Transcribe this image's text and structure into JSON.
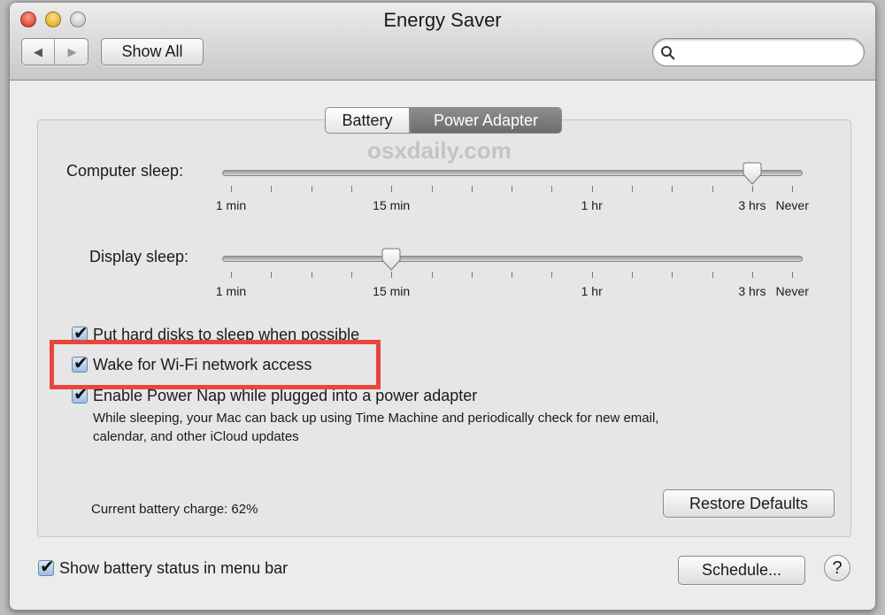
{
  "window": {
    "title": "Energy Saver",
    "show_all": "Show All",
    "search_placeholder": "",
    "back_icon": "back-arrow-icon",
    "forward_icon": "forward-arrow-icon"
  },
  "tabs": [
    {
      "label": "Battery",
      "selected": false
    },
    {
      "label": "Power Adapter",
      "selected": true
    }
  ],
  "watermark": "osxdaily.com",
  "sliders": [
    {
      "label": "Computer sleep:",
      "value": "3 hrs",
      "ticks": 15,
      "value_tick": 13
    },
    {
      "label": "Display sleep:",
      "value": "15 min",
      "ticks": 15,
      "value_tick": 4
    }
  ],
  "tick_labels": [
    {
      "text": "1 min",
      "tick": 0
    },
    {
      "text": "15 min",
      "tick": 4
    },
    {
      "text": "1 hr",
      "tick": 9
    },
    {
      "text": "3 hrs",
      "tick": 13
    },
    {
      "text": "Never",
      "tick": 14
    }
  ],
  "options": [
    {
      "label": "Put hard disks to sleep when possible",
      "checked": true
    },
    {
      "label": "Wake for Wi-Fi network access",
      "checked": true,
      "highlighted": true
    },
    {
      "label": "Enable Power Nap while plugged into a power adapter",
      "checked": true,
      "description_line1": "While sleeping, your Mac can back up using Time Machine and periodically check for new email,",
      "description_line2": "calendar, and other iCloud updates"
    }
  ],
  "battery_charge": "Current battery charge: 62%",
  "restore_defaults": "Restore Defaults",
  "show_battery_status": {
    "label": "Show battery status in menu bar",
    "checked": true
  },
  "schedule": "Schedule...",
  "help": "?",
  "colors": {
    "highlight": "#e8453c",
    "selected_tab": "#7a7a7a"
  }
}
